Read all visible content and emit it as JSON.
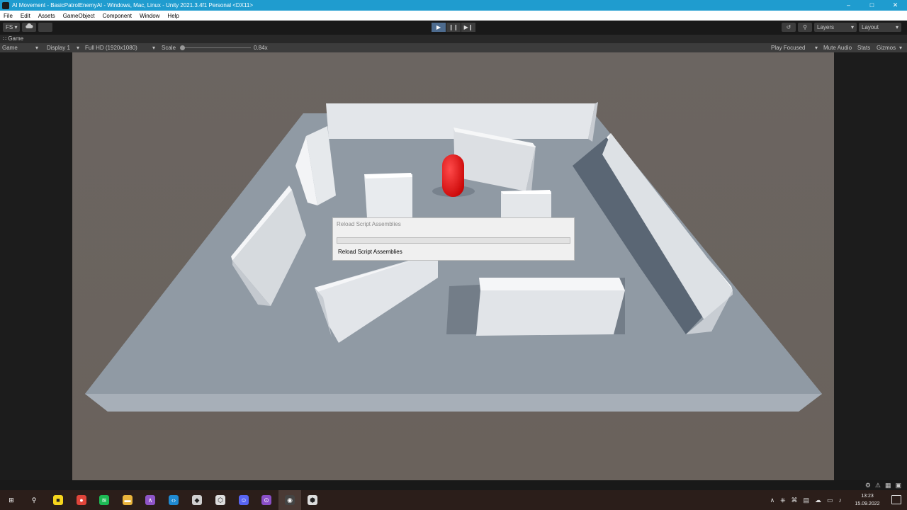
{
  "window": {
    "title": "AI Movement - BasicPatrolEnemyAI - Windows, Mac, Linux - Unity 2021.3.4f1 Personal <DX11>",
    "controls": [
      "–",
      "□",
      "✕"
    ]
  },
  "menu": [
    "File",
    "Edit",
    "Assets",
    "GameObject",
    "Component",
    "Window",
    "Help"
  ],
  "toolbar": {
    "account_label": "FS ▾",
    "cloud_icon": "cloud-icon",
    "play_icon": "▶",
    "pause_icon": "❙❙",
    "step_icon": "▶❙",
    "history_icon": "↺",
    "search_icon": "⚲",
    "layers_label": "Layers",
    "layout_label": "Layout",
    "dropdown_arrow": "▾"
  },
  "game_tab": {
    "tab_icon": "∷",
    "tab_label": "Game",
    "view_label": "Game",
    "display_label": "Display 1",
    "resolution_label": "Full HD (1920x1080)",
    "scale_label": "Scale",
    "scale_value": "0.84x",
    "play_focused_label": "Play Focused",
    "mute_audio_label": "Mute Audio",
    "stats_label": "Stats",
    "gizmos_label": "Gizmos",
    "dropdown_arrow": "▾"
  },
  "dialog": {
    "title": "Reload Script Assemblies",
    "progress": 0.0,
    "message": "Reload Script Assemblies"
  },
  "taskbar": {
    "apps": [
      {
        "name": "start",
        "glyph": "⊞",
        "color": "#2b1e1a"
      },
      {
        "name": "search",
        "glyph": "⚲",
        "color": "#2b1e1a"
      },
      {
        "name": "sticky-notes",
        "glyph": "■",
        "color": "#f7d51d"
      },
      {
        "name": "chrome",
        "glyph": "●",
        "color": "#e0453a"
      },
      {
        "name": "spotify",
        "glyph": "≋",
        "color": "#1db954"
      },
      {
        "name": "file-explorer",
        "glyph": "▬",
        "color": "#e9b43c"
      },
      {
        "name": "visual-studio",
        "glyph": "∧",
        "color": "#8f55c7"
      },
      {
        "name": "vs-code",
        "glyph": "‹›",
        "color": "#1f8ad2"
      },
      {
        "name": "unity-hub",
        "glyph": "◆",
        "color": "#cfcfcf"
      },
      {
        "name": "unity",
        "glyph": "⬡",
        "color": "#dddddd"
      },
      {
        "name": "discord",
        "glyph": "☺",
        "color": "#5865f2"
      },
      {
        "name": "github-desktop",
        "glyph": "⊙",
        "color": "#8a4fc7"
      },
      {
        "name": "obs",
        "glyph": "◉",
        "color": "#444444"
      },
      {
        "name": "unity-editor",
        "glyph": "⬢",
        "color": "#dddddd"
      }
    ],
    "tray_icons": [
      "∧",
      "⎈",
      "⌘",
      "▤",
      "☁",
      "▭",
      "♪"
    ],
    "time": "13:23",
    "date": "15.09.2022"
  },
  "statusbar_icons": [
    "⚙",
    "⚠",
    "▦",
    "▣"
  ]
}
